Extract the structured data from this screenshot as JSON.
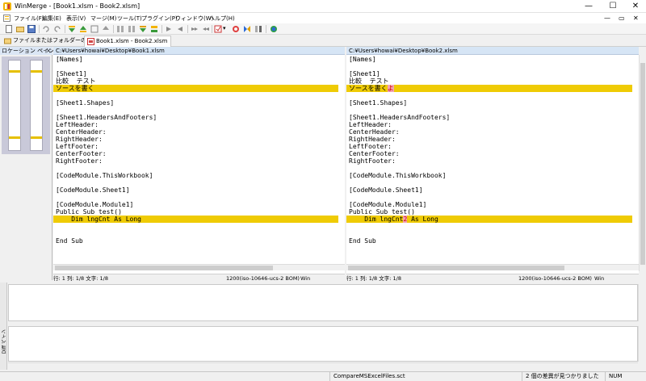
{
  "window": {
    "title": "WinMerge - [Book1.xlsm - Book2.xlsm]",
    "minimize_glyph": "—",
    "maximize_glyph": "☐",
    "close_glyph": "✕"
  },
  "menu": {
    "items": [
      {
        "label": "ファイル(F)"
      },
      {
        "label": "編集(E)"
      },
      {
        "label": "表示(V)"
      },
      {
        "label": "マージ(M)"
      },
      {
        "label": "ツール(T)"
      },
      {
        "label": "プラグイン(P)"
      },
      {
        "label": "ウィンドウ(W)"
      },
      {
        "label": "ヘルプ(H)"
      }
    ],
    "restore_glyph": "▭",
    "close_glyph": "✕",
    "minimize_glyph": "—"
  },
  "tabs": [
    {
      "label": "ファイルまたはフォルダーの選択..."
    },
    {
      "label": "Book1.xlsm - Book2.xlsm"
    }
  ],
  "location_pane": {
    "title": "ロケーション ペイン",
    "close_glyph": "×"
  },
  "left_pane": {
    "path": "C:¥Users¥howai¥Desktop¥Book1.xlsm",
    "lines": [
      {
        "text": "[Names]",
        "diff": false
      },
      {
        "text": "",
        "diff": false
      },
      {
        "text": "[Sheet1]",
        "diff": false
      },
      {
        "text": "比較  テスト",
        "diff": false
      },
      {
        "text": "ソースを書く",
        "diff": true
      },
      {
        "text": "",
        "diff": false
      },
      {
        "text": "[Sheet1.Shapes]",
        "diff": false
      },
      {
        "text": "",
        "diff": false
      },
      {
        "text": "[Sheet1.HeadersAndFooters]",
        "diff": false
      },
      {
        "text": "LeftHeader:",
        "diff": false
      },
      {
        "text": "CenterHeader:",
        "diff": false
      },
      {
        "text": "RightHeader:",
        "diff": false
      },
      {
        "text": "LeftFooter:",
        "diff": false
      },
      {
        "text": "CenterFooter:",
        "diff": false
      },
      {
        "text": "RightFooter:",
        "diff": false
      },
      {
        "text": "",
        "diff": false
      },
      {
        "text": "[CodeModule.ThisWorkbook]",
        "diff": false
      },
      {
        "text": "",
        "diff": false
      },
      {
        "text": "[CodeModule.Sheet1]",
        "diff": false
      },
      {
        "text": "",
        "diff": false
      },
      {
        "text": "[CodeModule.Module1]",
        "diff": false
      },
      {
        "text": "Public Sub test()",
        "diff": false
      },
      {
        "text": "    Dim lngCnt As Long",
        "diff": true
      },
      {
        "text": "",
        "diff": false
      },
      {
        "text": "",
        "diff": false
      },
      {
        "text": "End Sub",
        "diff": false
      }
    ],
    "status": {
      "pos": "行: 1  列: 1/8  文字: 1/8",
      "encoding": "1200(iso-10646-ucs-2 BOM)",
      "eol": "Win"
    }
  },
  "right_pane": {
    "path": "C:¥Users¥howai¥Desktop¥Book2.xlsm",
    "lines": [
      {
        "text": "[Names]",
        "diff": false
      },
      {
        "text": "",
        "diff": false
      },
      {
        "text": "[Sheet1]",
        "diff": false
      },
      {
        "text": "比較  テスト",
        "diff": false
      },
      {
        "text": "ソースを書く",
        "diff": true,
        "extra": "よ"
      },
      {
        "text": "",
        "diff": false
      },
      {
        "text": "[Sheet1.Shapes]",
        "diff": false
      },
      {
        "text": "",
        "diff": false
      },
      {
        "text": "[Sheet1.HeadersAndFooters]",
        "diff": false
      },
      {
        "text": "LeftHeader:",
        "diff": false
      },
      {
        "text": "CenterHeader:",
        "diff": false
      },
      {
        "text": "RightHeader:",
        "diff": false
      },
      {
        "text": "LeftFooter:",
        "diff": false
      },
      {
        "text": "CenterFooter:",
        "diff": false
      },
      {
        "text": "RightFooter:",
        "diff": false
      },
      {
        "text": "",
        "diff": false
      },
      {
        "text": "[CodeModule.ThisWorkbook]",
        "diff": false
      },
      {
        "text": "",
        "diff": false
      },
      {
        "text": "[CodeModule.Sheet1]",
        "diff": false
      },
      {
        "text": "",
        "diff": false
      },
      {
        "text": "[CodeModule.Module1]",
        "diff": false
      },
      {
        "text": "Public Sub test()",
        "diff": false
      },
      {
        "text": "    Dim lngCnt",
        "diff": true,
        "extra": "2",
        "rest": " As Long"
      },
      {
        "text": "",
        "diff": false
      },
      {
        "text": "",
        "diff": false
      },
      {
        "text": "End Sub",
        "diff": false
      }
    ],
    "status": {
      "pos": "行: 1  列: 1/8  文字: 1/8",
      "encoding": "1200(iso-10646-ucs-2 BOM)",
      "eol": "Win"
    }
  },
  "diff_pane": {
    "title": "Diff ペイン"
  },
  "status_bar": {
    "filter": "CompareMSExcelFiles.sct",
    "differences": "2 個の差異が見つかりました",
    "num": "NUM"
  },
  "colors": {
    "diff_line": "#efcb05",
    "diff_char_bg": "#f2a4b4",
    "diff_char_fg": "#d60000"
  }
}
